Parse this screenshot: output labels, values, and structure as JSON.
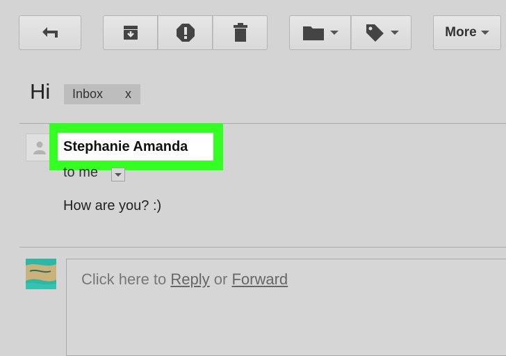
{
  "toolbar": {
    "back": {
      "icon": "back-arrow-icon"
    },
    "archive": {
      "icon": "archive-icon"
    },
    "spam": {
      "icon": "report-spam-icon"
    },
    "delete": {
      "icon": "trash-icon"
    },
    "move": {
      "icon": "folder-icon"
    },
    "labels": {
      "icon": "tag-icon"
    },
    "more_label": "More"
  },
  "message": {
    "subject": "Hi",
    "label_chip": {
      "name": "Inbox",
      "remove": "x"
    },
    "sender": "Stephanie Amanda",
    "recipient": "to me",
    "body": "How are you? :)"
  },
  "reply": {
    "prefix": "Click here to",
    "reply_link": "Reply",
    "middle": "or",
    "forward_link": "Forward"
  },
  "colors": {
    "highlight": "#33ff22",
    "background": "#d4d4d4"
  }
}
